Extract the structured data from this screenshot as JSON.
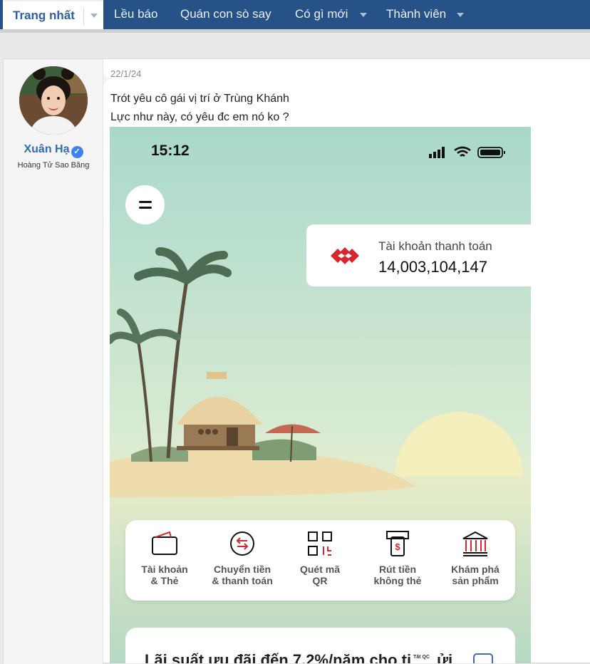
{
  "nav": {
    "home_label": "Trang nhất",
    "items": [
      "Lều báo",
      "Quán con sò say",
      "Có gì mới",
      "Thành viên"
    ]
  },
  "post": {
    "user": {
      "name": "Xuân Hạ",
      "title": "Hoàng Tử Sao Băng",
      "verified_icon": "check-badge-icon"
    },
    "date": "22/1/24",
    "lines": [
      "Trót yêu cô gái vị trí ở Trùng Khánh",
      "Lực như này, có yêu đc em nó ko ?"
    ]
  },
  "phone": {
    "time": "15:12",
    "account": {
      "label": "Tài khoản thanh toán",
      "balance": "14,003,104,147"
    },
    "actions": [
      {
        "icon": "wallet-icon",
        "line1": "Tài khoản",
        "line2": "& Thẻ"
      },
      {
        "icon": "transfer-icon",
        "line1": "Chuyển tiền",
        "line2": "& thanh toán"
      },
      {
        "icon": "qr-icon",
        "line1": "Quét mã",
        "line2": "QR"
      },
      {
        "icon": "atm-icon",
        "line1": "Rút tiền",
        "line2": "không thẻ"
      },
      {
        "icon": "bank-icon",
        "line1": "Khám phá",
        "line2": "sản phẩm"
      }
    ],
    "promo": {
      "text": "Lãi suất ưu đãi đến 7,2%/năm cho ti",
      "tag": "Tất QC",
      "tail": "ửi"
    },
    "colors": {
      "brand_red": "#d7262e",
      "sky": "#c4e1d2",
      "sand": "#efdcae"
    }
  }
}
